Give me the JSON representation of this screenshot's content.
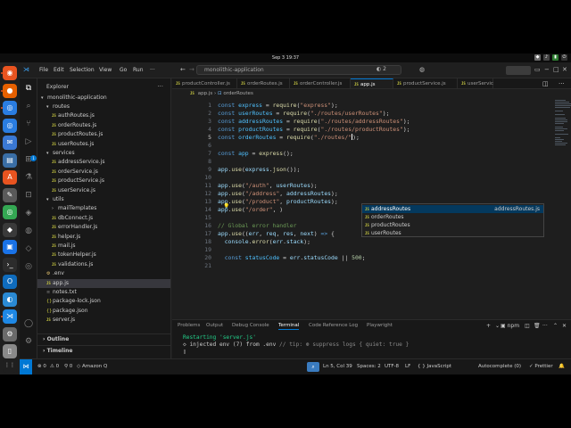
{
  "system": {
    "clock": "Sep 3  19:37",
    "tray_icons": [
      "network-icon",
      "volume-icon",
      "battery-icon",
      "power-icon"
    ]
  },
  "dock": {
    "apps": [
      {
        "name": "ubuntu-software",
        "glyph": "◉",
        "color": "#e95420"
      },
      {
        "name": "firefox",
        "glyph": "●",
        "color": "#e66000"
      },
      {
        "name": "chrome",
        "glyph": "◎",
        "color": "#2a7de1"
      },
      {
        "name": "chromium",
        "glyph": "◎",
        "color": "#2a7de1"
      },
      {
        "name": "thunderbird",
        "glyph": "✉",
        "color": "#3a78d4"
      },
      {
        "name": "files",
        "glyph": "▤",
        "color": "#3a6ea5"
      },
      {
        "name": "software-center",
        "glyph": "A",
        "color": "#e95420"
      },
      {
        "name": "text-editor",
        "glyph": "✎",
        "color": "#5a5a5a"
      },
      {
        "name": "google-chrome",
        "glyph": "◎",
        "color": "#34a853"
      },
      {
        "name": "inkscape",
        "glyph": "◆",
        "color": "#3a3a3a"
      },
      {
        "name": "app-blue",
        "glyph": "▣",
        "color": "#1a73e8"
      },
      {
        "name": "terminal",
        "glyph": "›_",
        "color": "#2c2c2c"
      },
      {
        "name": "outlook",
        "glyph": "O",
        "color": "#0f6cbd"
      },
      {
        "name": "app-edge",
        "glyph": "◐",
        "color": "#2a8ad4"
      },
      {
        "name": "vscode",
        "glyph": "⋊",
        "color": "#1e88e5"
      },
      {
        "name": "settings",
        "glyph": "⚙",
        "color": "#6b6b6b"
      },
      {
        "name": "trash",
        "glyph": "▯",
        "color": "#8a8a8a"
      },
      {
        "name": "app-green",
        "glyph": "●",
        "color": "#2e7d32"
      },
      {
        "name": "show-apps",
        "glyph": "⋮⋮",
        "color": "#1f1f1f"
      }
    ]
  },
  "titlebar": {
    "menus": [
      "File",
      "Edit",
      "Selection",
      "View",
      "Go",
      "Run",
      "···"
    ],
    "command_center": "monolithic-application",
    "copilot_count": "2"
  },
  "explorer": {
    "title": "Explorer",
    "more": "···",
    "root": "monolithic-application",
    "items": [
      {
        "label": "routes",
        "type": "folder-open",
        "depth": 1
      },
      {
        "label": "authRoutes.js",
        "type": "js",
        "depth": 2
      },
      {
        "label": "orderRoutes.js",
        "type": "js",
        "depth": 2
      },
      {
        "label": "productRoutes.js",
        "type": "js",
        "depth": 2
      },
      {
        "label": "userRoutes.js",
        "type": "js",
        "depth": 2
      },
      {
        "label": "services",
        "type": "folder-open",
        "depth": 1
      },
      {
        "label": "addressService.js",
        "type": "js",
        "depth": 2
      },
      {
        "label": "orderService.js",
        "type": "js",
        "depth": 2
      },
      {
        "label": "productService.js",
        "type": "js",
        "depth": 2
      },
      {
        "label": "userService.js",
        "type": "js",
        "depth": 2
      },
      {
        "label": "utils",
        "type": "folder-open",
        "depth": 1
      },
      {
        "label": "mailTemplates",
        "type": "folder",
        "depth": 2
      },
      {
        "label": "dbConnect.js",
        "type": "js",
        "depth": 2
      },
      {
        "label": "errorHandler.js",
        "type": "js",
        "depth": 2
      },
      {
        "label": "helper.js",
        "type": "js",
        "depth": 2
      },
      {
        "label": "mail.js",
        "type": "js",
        "depth": 2
      },
      {
        "label": "tokenHelper.js",
        "type": "js",
        "depth": 2
      },
      {
        "label": "validations.js",
        "type": "js",
        "depth": 2
      },
      {
        "label": ".env",
        "type": "env",
        "depth": 1
      },
      {
        "label": "app.js",
        "type": "js",
        "depth": 1,
        "selected": true
      },
      {
        "label": "notes.txt",
        "type": "txt",
        "depth": 1
      },
      {
        "label": "package-lock.json",
        "type": "json",
        "depth": 1
      },
      {
        "label": "package.json",
        "type": "json",
        "depth": 1
      },
      {
        "label": "server.js",
        "type": "js",
        "depth": 1
      }
    ],
    "outline": "Outline",
    "timeline": "Timeline"
  },
  "tabs": [
    {
      "label": "productController.js",
      "active": false
    },
    {
      "label": "orderRoutes.js",
      "active": false
    },
    {
      "label": "orderController.js",
      "active": false
    },
    {
      "label": "app.js",
      "active": true
    },
    {
      "label": "productService.js",
      "active": false
    },
    {
      "label": "userServic",
      "active": false
    }
  ],
  "breadcrumb": {
    "file": "app.js",
    "sep": "›",
    "symbol": "orderRoutes"
  },
  "editor": {
    "lines": [
      {
        "n": "1",
        "tokens": [
          [
            "kw",
            "const "
          ],
          [
            "var",
            "express"
          ],
          [
            "pn",
            " = "
          ],
          [
            "fn",
            "require"
          ],
          [
            "pn",
            "("
          ],
          [
            "str",
            "\"express\""
          ],
          [
            "pn",
            ");"
          ]
        ]
      },
      {
        "n": "2",
        "tokens": [
          [
            "kw",
            "const "
          ],
          [
            "var",
            "userRoutes"
          ],
          [
            "pn",
            " = "
          ],
          [
            "fn",
            "require"
          ],
          [
            "pn",
            "("
          ],
          [
            "str",
            "\"./routes/userRoutes\""
          ],
          [
            "pn",
            ");"
          ]
        ]
      },
      {
        "n": "3",
        "tokens": [
          [
            "kw",
            "const "
          ],
          [
            "var",
            "addressRoutes"
          ],
          [
            "pn",
            " = "
          ],
          [
            "fn",
            "require"
          ],
          [
            "pn",
            "("
          ],
          [
            "str",
            "\"./routes/addressRoutes\""
          ],
          [
            "pn",
            ");"
          ]
        ]
      },
      {
        "n": "4",
        "tokens": [
          [
            "kw",
            "const "
          ],
          [
            "var",
            "productRoutes"
          ],
          [
            "pn",
            " = "
          ],
          [
            "fn",
            "require"
          ],
          [
            "pn",
            "("
          ],
          [
            "str",
            "\"./routes/productRoutes\""
          ],
          [
            "pn",
            ");"
          ]
        ]
      },
      {
        "n": "5",
        "current": true,
        "tokens": [
          [
            "kw",
            "const "
          ],
          [
            "var",
            "orderRoutes"
          ],
          [
            "pn",
            " = "
          ],
          [
            "fn",
            "require"
          ],
          [
            "pn",
            "("
          ],
          [
            "str",
            "\"./routes/\""
          ],
          [
            "cursor",
            ""
          ],
          [
            "pn",
            ");"
          ]
        ]
      },
      {
        "n": "6",
        "tokens": []
      },
      {
        "n": "7",
        "tokens": [
          [
            "kw",
            "const "
          ],
          [
            "var",
            "app"
          ],
          [
            "pn",
            " = "
          ],
          [
            "fn",
            "express"
          ],
          [
            "pn",
            "();"
          ]
        ]
      },
      {
        "n": "8",
        "tokens": []
      },
      {
        "n": "9",
        "tokens": [
          [
            "id",
            "app"
          ],
          [
            "pn",
            "."
          ],
          [
            "fn",
            "use"
          ],
          [
            "pn",
            "("
          ],
          [
            "id",
            "express"
          ],
          [
            "pn",
            "."
          ],
          [
            "fn",
            "json"
          ],
          [
            "pn",
            "());"
          ]
        ]
      },
      {
        "n": "10",
        "tokens": []
      },
      {
        "n": "11",
        "tokens": [
          [
            "id",
            "app"
          ],
          [
            "pn",
            "."
          ],
          [
            "fn",
            "use"
          ],
          [
            "pn",
            "("
          ],
          [
            "str",
            "\"/auth\""
          ],
          [
            "pn",
            ", "
          ],
          [
            "id",
            "userRoutes"
          ],
          [
            "pn",
            ");"
          ]
        ]
      },
      {
        "n": "12",
        "tokens": [
          [
            "id",
            "app"
          ],
          [
            "pn",
            "."
          ],
          [
            "fn",
            "use"
          ],
          [
            "pn",
            "("
          ],
          [
            "str",
            "\"/address\""
          ],
          [
            "pn",
            ", "
          ],
          [
            "id",
            "addressRoutes"
          ],
          [
            "pn",
            ");"
          ]
        ]
      },
      {
        "n": "13",
        "tokens": [
          [
            "id",
            "app"
          ],
          [
            "pn",
            "."
          ],
          [
            "fn",
            "use"
          ],
          [
            "pn",
            "("
          ],
          [
            "str",
            "\"/product\""
          ],
          [
            "pn",
            ", "
          ],
          [
            "id",
            "productRoutes"
          ],
          [
            "pn",
            ");"
          ]
        ]
      },
      {
        "n": "14",
        "tokens": [
          [
            "id",
            "app"
          ],
          [
            "pn",
            "."
          ],
          [
            "fn",
            "use"
          ],
          [
            "pn",
            "("
          ],
          [
            "str",
            "\"/order\""
          ],
          [
            "pn",
            ", )"
          ]
        ]
      },
      {
        "n": "15",
        "tokens": []
      },
      {
        "n": "16",
        "tokens": [
          [
            "cm",
            "// Global error handler"
          ]
        ]
      },
      {
        "n": "17",
        "tokens": [
          [
            "id",
            "app"
          ],
          [
            "pn",
            "."
          ],
          [
            "fn",
            "use"
          ],
          [
            "pn",
            "(("
          ],
          [
            "id",
            "err"
          ],
          [
            "pn",
            ", "
          ],
          [
            "id",
            "req"
          ],
          [
            "pn",
            ", "
          ],
          [
            "id",
            "res"
          ],
          [
            "pn",
            ", "
          ],
          [
            "id",
            "next"
          ],
          [
            "pn",
            ") "
          ],
          [
            "kw",
            "=>"
          ],
          [
            "pn",
            " {"
          ]
        ]
      },
      {
        "n": "18",
        "tokens": [
          [
            "pn",
            "  "
          ],
          [
            "id",
            "console"
          ],
          [
            "pn",
            "."
          ],
          [
            "fn",
            "error"
          ],
          [
            "pn",
            "("
          ],
          [
            "id",
            "err"
          ],
          [
            "pn",
            "."
          ],
          [
            "id",
            "stack"
          ],
          [
            "pn",
            ");"
          ]
        ]
      },
      {
        "n": "19",
        "tokens": []
      },
      {
        "n": "20",
        "tokens": [
          [
            "pn",
            "  "
          ],
          [
            "kw",
            "const "
          ],
          [
            "var",
            "statusCode"
          ],
          [
            "pn",
            " = "
          ],
          [
            "id",
            "err"
          ],
          [
            "pn",
            "."
          ],
          [
            "id",
            "statusCode"
          ],
          [
            "pn",
            " || "
          ],
          [
            "num",
            "500"
          ],
          [
            "pn",
            ";"
          ]
        ]
      },
      {
        "n": "21",
        "tokens": []
      }
    ],
    "suggestions": [
      {
        "label": "addressRoutes",
        "detail": "addressRoutes.js",
        "selected": true
      },
      {
        "label": "orderRoutes",
        "detail": ""
      },
      {
        "label": "productRoutes",
        "detail": ""
      },
      {
        "label": "userRoutes",
        "detail": ""
      }
    ]
  },
  "panel": {
    "tabs": [
      {
        "label": "Problems",
        "active": false
      },
      {
        "label": "Output",
        "active": false
      },
      {
        "label": "Debug Console",
        "active": false
      },
      {
        "label": "Terminal",
        "active": true
      },
      {
        "label": "Code Reference Log",
        "active": false
      },
      {
        "label": "Playwright",
        "active": false
      }
    ],
    "terminal_profile": "npm",
    "terminal": {
      "line1": "Restarting 'server.js'",
      "line2_prefix": "◇ injected env (7) from .env ",
      "line2_tip": "// tip: ⊛ suppress logs { quiet: true }",
      "prompt": "▯"
    }
  },
  "statusbar": {
    "remote": "⋈",
    "errors": "⊗ 0",
    "warnings": "⚠ 0",
    "ports": "⚲ 0",
    "amazonq": "Amazon Q",
    "position": "Ln 5, Col 39",
    "spaces": "Spaces: 2",
    "encoding": "UTF-8",
    "eol": "LF",
    "language": "{ } JavaScript",
    "autocomplete": "Autocomplete (0)",
    "prettier": "✓ Prettier"
  }
}
